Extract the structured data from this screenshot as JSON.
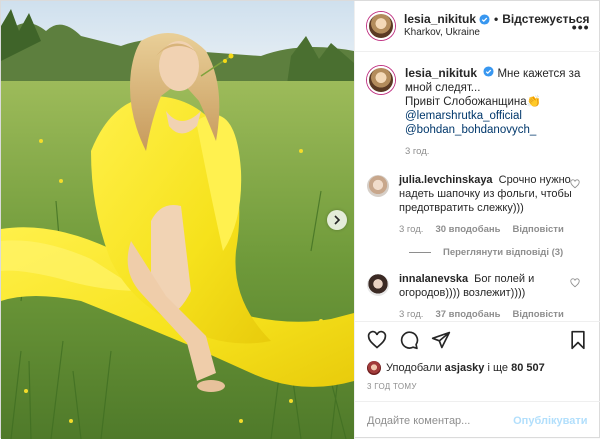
{
  "post": {
    "author": "lesia_nikituk",
    "follow_label": "Відстежується",
    "location": "Kharkov, Ukraine",
    "more_label": "•••"
  },
  "caption": {
    "author": "lesia_nikituk",
    "line1": "Мне кажется за мной следят...",
    "line2": "Привіт Слобожанщина",
    "emoji": "👏",
    "mention1": "@lemarshrutka_official",
    "mention2": "@bohdan_bohdanovych_",
    "time": "3 год."
  },
  "comments": [
    {
      "author": "julia.levchinskaya",
      "text": "Срочно нужно надеть шапочку из фольги, чтобы предотвратить слежку)))",
      "time": "3 год.",
      "likes": "30 вподобань",
      "reply": "Відповісти"
    },
    {
      "author": "innalanevska",
      "text": "Бог полей и огородов)))) возлежит))))",
      "time": "3 год.",
      "likes": "37 вподобань",
      "reply": "Відповісти"
    }
  ],
  "view_replies": "Переглянути відповіді (3)",
  "likes_summary": {
    "prefix": "Уподобали",
    "user": "asjasky",
    "mid": "і ще",
    "count": "80 507"
  },
  "time_ago": "3 ГОД ТОМУ",
  "add_comment": {
    "placeholder": "Додайте коментар...",
    "publish": "Опублікувати"
  },
  "icons": [
    "verified-icon",
    "heart-icon",
    "comment-icon",
    "share-icon",
    "bookmark-icon",
    "chevron-right-icon"
  ],
  "colors": {
    "link": "#00376b",
    "muted": "#8e8e8e",
    "verified": "#3897f0",
    "publish_disabled": "#b2dffc"
  }
}
